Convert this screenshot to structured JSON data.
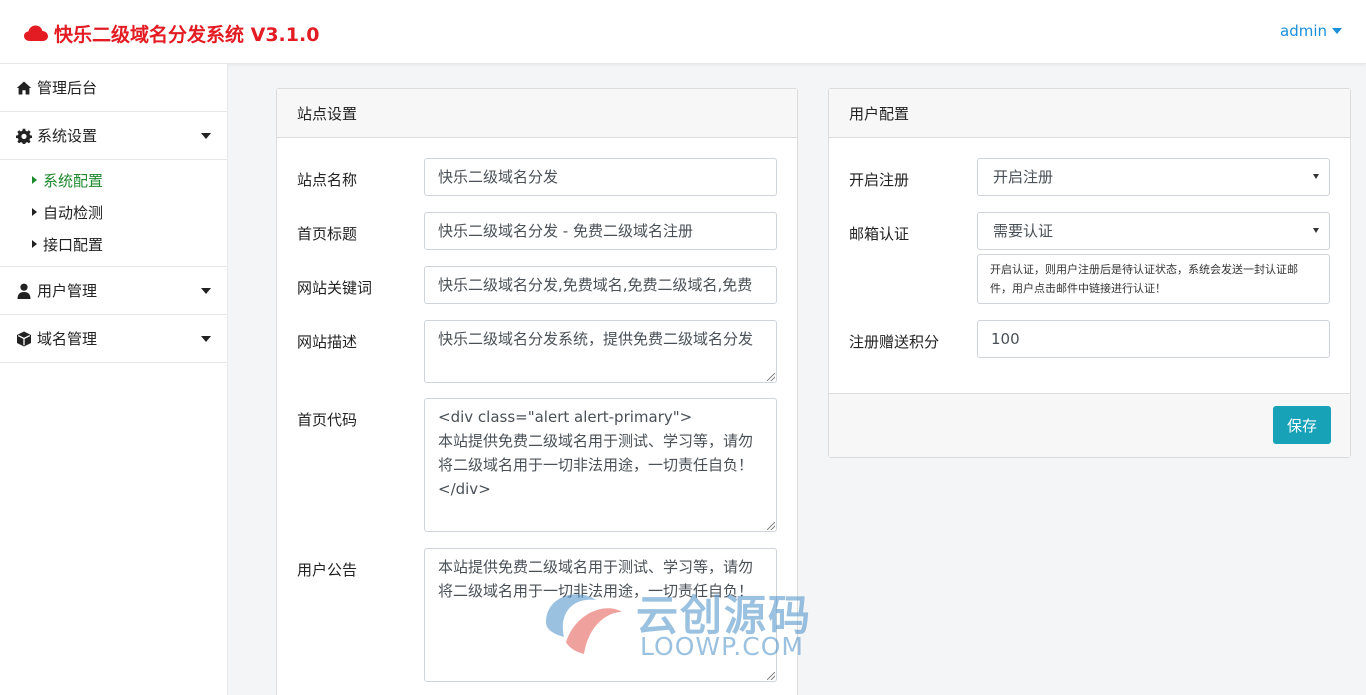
{
  "header": {
    "brand": "快乐二级域名分发系统 V3.1.0",
    "user": "admin"
  },
  "sidebar": {
    "admin_home": "管理后台",
    "system_settings": "系统设置",
    "sub": {
      "system_config": "系统配置",
      "auto_check": "自动检测",
      "api_config": "接口配置"
    },
    "user_management": "用户管理",
    "domain_management": "域名管理"
  },
  "site_settings": {
    "title": "站点设置",
    "site_name_label": "站点名称",
    "site_name_value": "快乐二级域名分发",
    "home_title_label": "首页标题",
    "home_title_value": "快乐二级域名分发 - 免费二级域名注册",
    "keywords_label": "网站关键词",
    "keywords_value": "快乐二级域名分发,免费域名,免费二级域名,免费",
    "description_label": "网站描述",
    "description_value": "快乐二级域名分发系统，提供免费二级域名分发",
    "home_code_label": "首页代码",
    "home_code_lines": [
      "<div class=\"alert alert-primary\">",
      "本站提供免费二级域名用于测试、学习等，请勿将二级域名用于一切非法用途，一切责任自负！",
      "</div>"
    ],
    "notice_label": "用户公告",
    "notice_value": "本站提供免费二级域名用于测试、学习等，请勿将二级域名用于一切非法用途，一切责任自负！"
  },
  "user_config": {
    "title": "用户配置",
    "enable_register_label": "开启注册",
    "enable_register_value": "开启注册",
    "email_verify_label": "邮箱认证",
    "email_verify_value": "需要认证",
    "email_verify_help": "开启认证，则用户注册后是待认证状态，系统会发送一封认证邮件，用户点击邮件中链接进行认证！",
    "register_points_label": "注册赠送积分",
    "register_points_value": "100",
    "save_label": "保存"
  },
  "watermark": {
    "title": "云创源码",
    "sub": "LOOWP.COM"
  },
  "colors": {
    "brand": "#e31b23",
    "link": "#1a8fd9",
    "active": "#1e8a2e",
    "button": "#17a2b8"
  }
}
